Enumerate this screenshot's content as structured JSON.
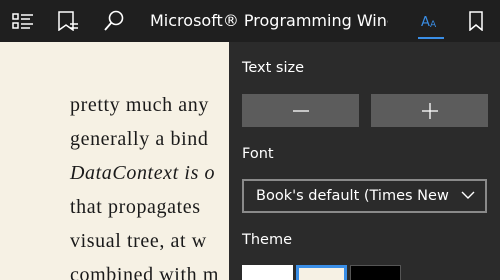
{
  "toolbar": {
    "title": "Microsoft® Programming Windo...",
    "icons": [
      "contents-icon",
      "bookmarks-list-icon",
      "search-icon",
      "text-format-icon",
      "bookmark-icon"
    ],
    "accent_color": "#3a8ee6"
  },
  "book": {
    "lines": [
      "pretty much any",
      "generally a bind",
      "DataContext is o",
      "that propagates",
      "visual tree, at w",
      "combined with m"
    ]
  },
  "panel": {
    "text_size_label": "Text size",
    "decrease_icon": "minus-icon",
    "increase_icon": "plus-icon",
    "font_label": "Font",
    "font_value": "Book's default (Times New",
    "theme_label": "Theme",
    "themes": [
      {
        "name": "light",
        "color": "#ffffff"
      },
      {
        "name": "sepia",
        "color": "#f6f1e4",
        "selected": true
      },
      {
        "name": "dark",
        "color": "#000000"
      }
    ]
  }
}
